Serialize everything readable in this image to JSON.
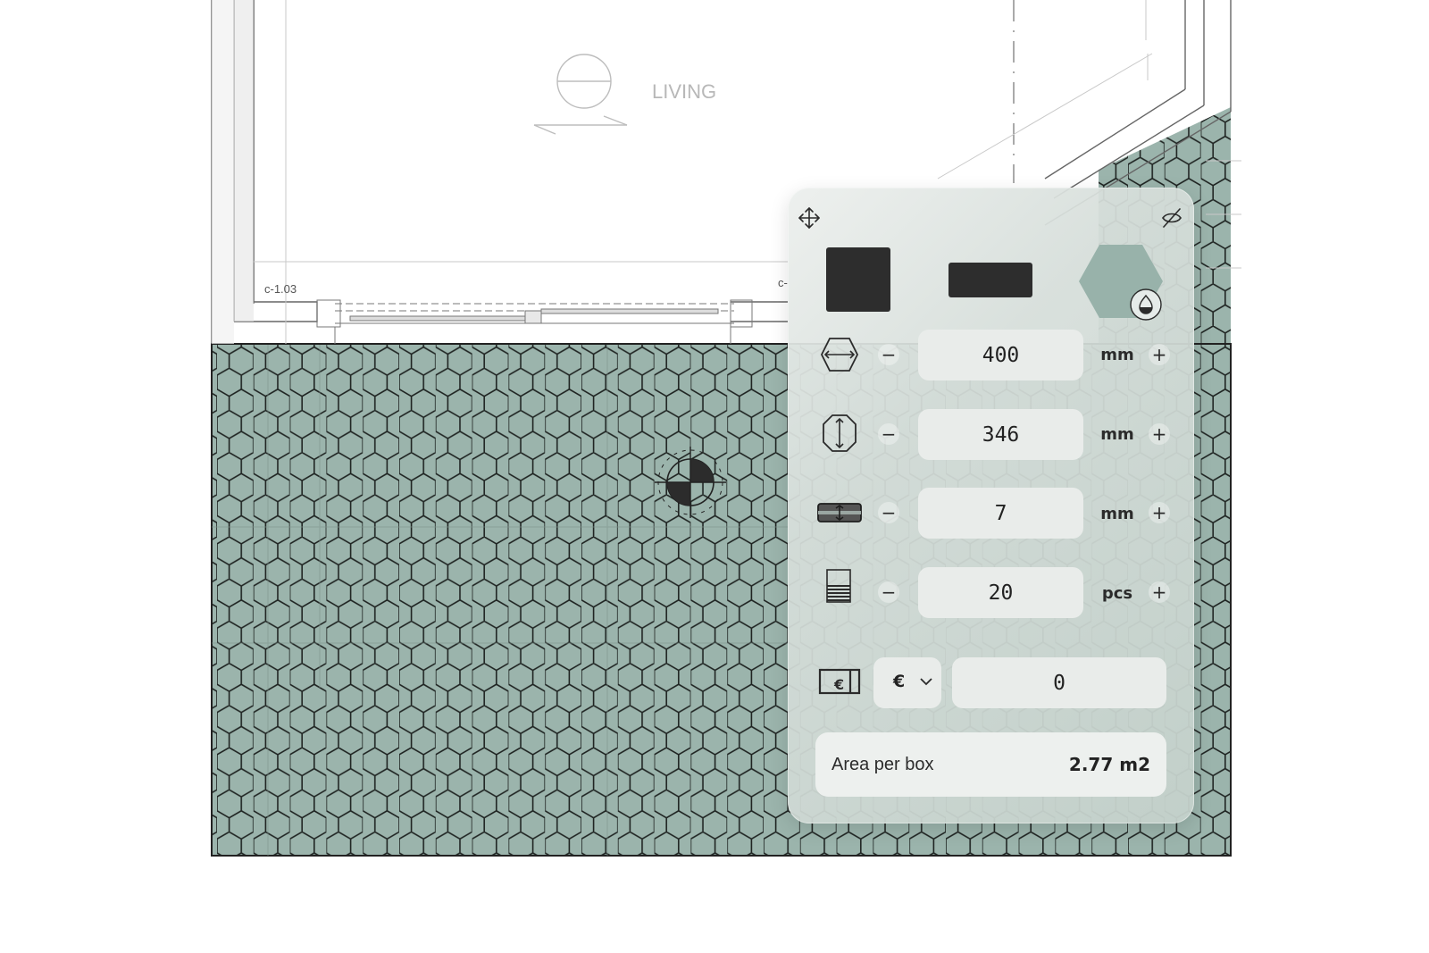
{
  "plan": {
    "room_label": "LIVING",
    "room_code": "c-1.03",
    "room_code_cut": "c-",
    "tile_color": "#9bb4ac",
    "grout_color": "#222222"
  },
  "panel": {
    "move_icon": "move-arrows-icon",
    "hide_icon": "eye-off-icon",
    "shapes": [
      {
        "name": "square",
        "color": "#2d2d2d"
      },
      {
        "name": "rectangle",
        "color": "#2d2d2d"
      },
      {
        "name": "hexagon",
        "color": "#98b2aa",
        "selected": true
      }
    ],
    "color_picker_icon": "droplet-icon",
    "rows": [
      {
        "id": "tile-width",
        "icon": "hex-width-icon",
        "value": "400",
        "unit": "mm"
      },
      {
        "id": "tile-height",
        "icon": "hex-height-icon",
        "value": "346",
        "unit": "mm"
      },
      {
        "id": "joint-width",
        "icon": "joint-gap-icon",
        "value": "7",
        "unit": "mm"
      },
      {
        "id": "pieces-per-box",
        "icon": "stack-icon",
        "value": "20",
        "unit": "pcs"
      }
    ],
    "minus_label": "−",
    "plus_label": "+",
    "price": {
      "icon": "price-tag-icon",
      "currency": "€",
      "value": "0"
    },
    "area": {
      "label": "Area per box",
      "value": "2.77 m2"
    }
  }
}
